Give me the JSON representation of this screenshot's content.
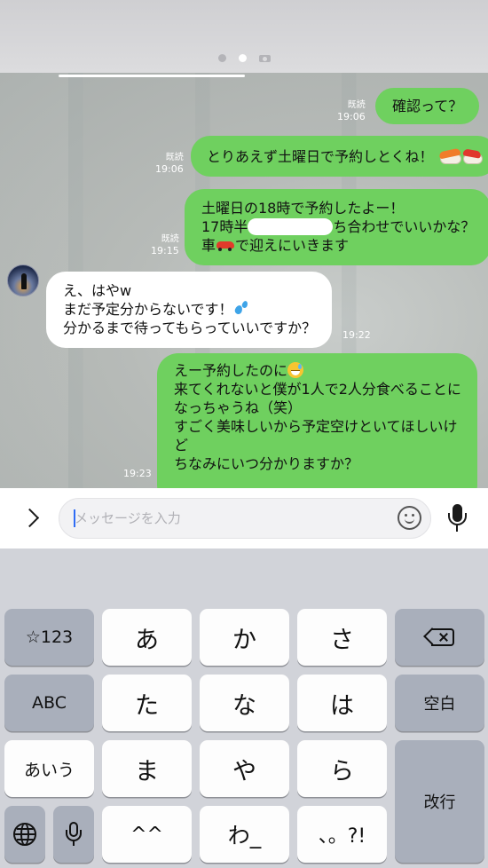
{
  "status": {
    "page_indicator": [
      "dot",
      "dot-active",
      "camera-icon"
    ]
  },
  "chat": {
    "messages": [
      {
        "from": "me",
        "lines": [
          "確認って？"
        ],
        "read": "既読",
        "time": "19:06"
      },
      {
        "from": "me",
        "lines": [
          "とりあえず土曜日で予約しとくね！"
        ],
        "emoji": "sushi-emoji",
        "read": "既読",
        "time": "19:06"
      },
      {
        "from": "me",
        "lines": [
          "土曜日の18時で予約したよー！",
          "17時半",
          "ち合わせでいいかな？",
          "車",
          "で迎えにいきます"
        ],
        "emoji": "car-emoji",
        "redacted": true,
        "read": "既読",
        "time": "19:15"
      },
      {
        "from": "them",
        "lines": [
          "え、はやw",
          "まだ予定分からないです！",
          "分かるまで待ってもらっていいですか？"
        ],
        "emoji": "sweat-drops-emoji",
        "time": "19:22"
      },
      {
        "from": "me",
        "lines": [
          "えー予約したのに",
          "来てくれないと僕が1人で2人分食べることに",
          "なっちゃうね（笑）",
          "すごく美味しいから予定空けといてほしいけ",
          "ど",
          "ちなみにいつ分かりますか？"
        ],
        "emoji": "sweat-smile-emoji",
        "time": "19:23"
      }
    ]
  },
  "input_bar": {
    "expand_icon": "chevron-right-icon",
    "placeholder": "メッセージを入力",
    "emoji_icon": "smiley-icon",
    "mic_icon": "microphone-icon"
  },
  "keyboard": {
    "symbols_key": "☆123",
    "abc_key": "ABC",
    "aiu_key": "あいう",
    "row1": [
      "あ",
      "か",
      "さ"
    ],
    "row2": [
      "た",
      "な",
      "は"
    ],
    "row3": [
      "ま",
      "や",
      "ら"
    ],
    "row4": [
      "^^",
      "わ_",
      "、。?!"
    ],
    "space_key": "空白",
    "return_key": "改行",
    "backspace_icon": "backspace-icon",
    "globe_icon": "globe-icon",
    "dictation_icon": "microphone-icon"
  },
  "colors": {
    "my_bubble": "#6fd05f",
    "their_bubble": "#ffffff",
    "caret": "#2f6cf5"
  }
}
